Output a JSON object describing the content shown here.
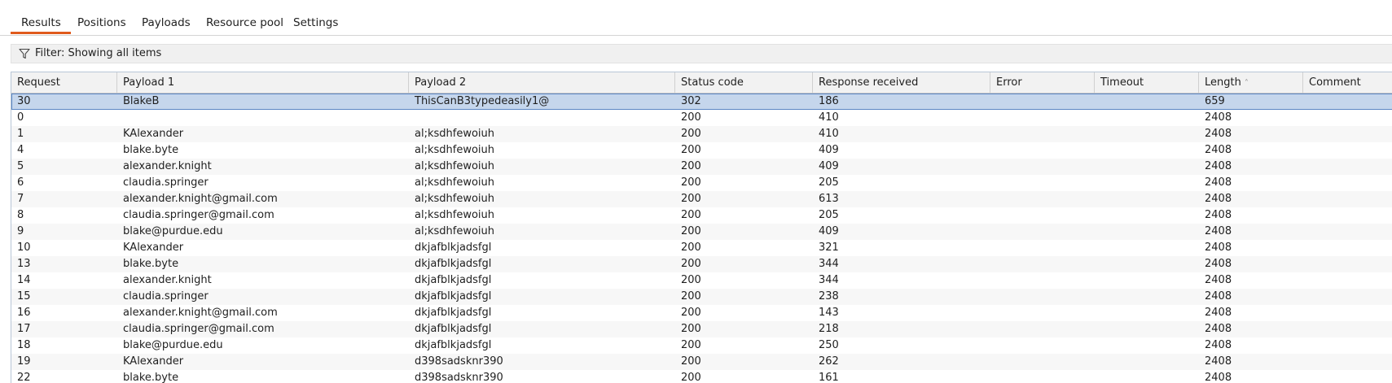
{
  "tabs": [
    {
      "label": "Results",
      "active": true
    },
    {
      "label": "Positions",
      "active": false
    },
    {
      "label": "Payloads",
      "active": false
    },
    {
      "label": "Resource pool",
      "active": false
    },
    {
      "label": "Settings",
      "active": false
    }
  ],
  "filter": {
    "icon": "filter-icon",
    "text": "Filter: Showing all items"
  },
  "accent_color": "#e05a1c",
  "table": {
    "columns": [
      "Request",
      "Payload 1",
      "Payload 2",
      "Status code",
      "Response received",
      "Error",
      "Timeout",
      "Length",
      "Comment"
    ],
    "sorted_column": "Length",
    "sort_direction": "ascending",
    "selected_row": 0,
    "rows": [
      [
        "30",
        "BlakeB",
        "ThisCanB3typedeasily1@",
        "302",
        "186",
        "",
        "",
        "659",
        ""
      ],
      [
        "0",
        "",
        "",
        "200",
        "410",
        "",
        "",
        "2408",
        ""
      ],
      [
        "1",
        "KAlexander",
        "al;ksdhfewoiuh",
        "200",
        "410",
        "",
        "",
        "2408",
        ""
      ],
      [
        "4",
        "blake.byte",
        "al;ksdhfewoiuh",
        "200",
        "409",
        "",
        "",
        "2408",
        ""
      ],
      [
        "5",
        "alexander.knight",
        "al;ksdhfewoiuh",
        "200",
        "409",
        "",
        "",
        "2408",
        ""
      ],
      [
        "6",
        "claudia.springer",
        "al;ksdhfewoiuh",
        "200",
        "205",
        "",
        "",
        "2408",
        ""
      ],
      [
        "7",
        "alexander.knight@gmail.com",
        "al;ksdhfewoiuh",
        "200",
        "613",
        "",
        "",
        "2408",
        ""
      ],
      [
        "8",
        "claudia.springer@gmail.com",
        "al;ksdhfewoiuh",
        "200",
        "205",
        "",
        "",
        "2408",
        ""
      ],
      [
        "9",
        "blake@purdue.edu",
        "al;ksdhfewoiuh",
        "200",
        "409",
        "",
        "",
        "2408",
        ""
      ],
      [
        "10",
        "KAlexander",
        "dkjafblkjadsfgl",
        "200",
        "321",
        "",
        "",
        "2408",
        ""
      ],
      [
        "13",
        "blake.byte",
        "dkjafblkjadsfgl",
        "200",
        "344",
        "",
        "",
        "2408",
        ""
      ],
      [
        "14",
        "alexander.knight",
        "dkjafblkjadsfgl",
        "200",
        "344",
        "",
        "",
        "2408",
        ""
      ],
      [
        "15",
        "claudia.springer",
        "dkjafblkjadsfgl",
        "200",
        "238",
        "",
        "",
        "2408",
        ""
      ],
      [
        "16",
        "alexander.knight@gmail.com",
        "dkjafblkjadsfgl",
        "200",
        "143",
        "",
        "",
        "2408",
        ""
      ],
      [
        "17",
        "claudia.springer@gmail.com",
        "dkjafblkjadsfgl",
        "200",
        "218",
        "",
        "",
        "2408",
        ""
      ],
      [
        "18",
        "blake@purdue.edu",
        "dkjafblkjadsfgl",
        "200",
        "250",
        "",
        "",
        "2408",
        ""
      ],
      [
        "19",
        "KAlexander",
        "d398sadsknr390",
        "200",
        "262",
        "",
        "",
        "2408",
        ""
      ],
      [
        "22",
        "blake.byte",
        "d398sadsknr390",
        "200",
        "161",
        "",
        "",
        "2408",
        ""
      ]
    ]
  }
}
